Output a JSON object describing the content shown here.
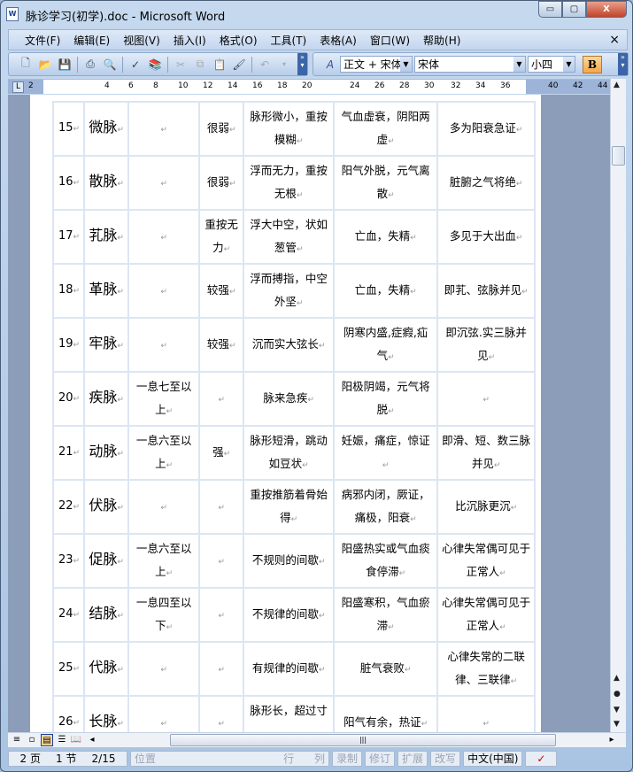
{
  "window": {
    "title": "脉诊学习(初学).doc - Microsoft Word",
    "app_icon": "W",
    "minimize": "▭",
    "maximize": "▢",
    "close": "X"
  },
  "menu": [
    "文件(F)",
    "编辑(E)",
    "视图(V)",
    "插入(I)",
    "格式(O)",
    "工具(T)",
    "表格(A)",
    "窗口(W)",
    "帮助(H)"
  ],
  "menu_close": "×",
  "formatting": {
    "style": "正文 + 宋体",
    "font": "宋体",
    "size": "小四",
    "bold": "B"
  },
  "ruler": [
    "2",
    "4",
    "6",
    "8",
    "10",
    "12",
    "14",
    "16",
    "18",
    "20",
    "24",
    "26",
    "28",
    "30",
    "32",
    "34",
    "36",
    "40",
    "42",
    "44"
  ],
  "table_rows": [
    [
      "15",
      "微脉",
      "",
      "很弱",
      "脉形微小，重按模糊",
      "气血虚衰，阴阳两虚",
      "多为阳衰急证"
    ],
    [
      "16",
      "散脉",
      "",
      "很弱",
      "浮而无力，重按无根",
      "阳气外脱，元气离散",
      "脏腑之气将绝"
    ],
    [
      "17",
      "芤脉",
      "",
      "重按无力",
      "浮大中空，状如葱管",
      "亡血，失精",
      "多见于大出血"
    ],
    [
      "18",
      "革脉",
      "",
      "较强",
      "浮而搏指，中空外坚",
      "亡血，失精",
      "即芤、弦脉并见"
    ],
    [
      "19",
      "牢脉",
      "",
      "较强",
      "沉而实大弦长",
      "阴寒内盛,症瘕,疝气",
      "即沉弦.实三脉并见"
    ],
    [
      "20",
      "疾脉",
      "一息七至以上",
      "",
      "脉来急疾",
      "阳极阴竭，元气将脱",
      ""
    ],
    [
      "21",
      "动脉",
      "一息六至以上",
      "强",
      "脉形短滑，跳动如豆状",
      "妊娠，痛症，惊证",
      "即滑、短、数三脉并见"
    ],
    [
      "22",
      "伏脉",
      "",
      "",
      "重按推筋着骨始得",
      "病邪内闭，厥证，痛极，阳衰",
      "比沉脉更沉"
    ],
    [
      "23",
      "促脉",
      "一息六至以上",
      "",
      "不规则的间歇",
      "阳盛热实或气血痰食停滞",
      "心律失常偶可见于正常人"
    ],
    [
      "24",
      "结脉",
      "一息四至以下",
      "",
      "不规律的间歇",
      "阳盛寒积，气血瘀滞",
      "心律失常偶可见于正常人"
    ],
    [
      "25",
      "代脉",
      "",
      "",
      "有规律的间歇",
      "脏气衰败",
      "心律失常的二联律、三联律"
    ],
    [
      "26",
      "长脉",
      "",
      "",
      "脉形长，超过寸",
      "阳气有余，热证",
      ""
    ]
  ],
  "paragraph_mark": "↵",
  "status": {
    "page": "2 页",
    "section": "1 节",
    "pages": "2/15",
    "position": "位置",
    "line": "行",
    "col": "列",
    "rec": "录制",
    "trk": "修订",
    "ext": "扩展",
    "ovr": "改写",
    "lang": "中文(中国)"
  }
}
